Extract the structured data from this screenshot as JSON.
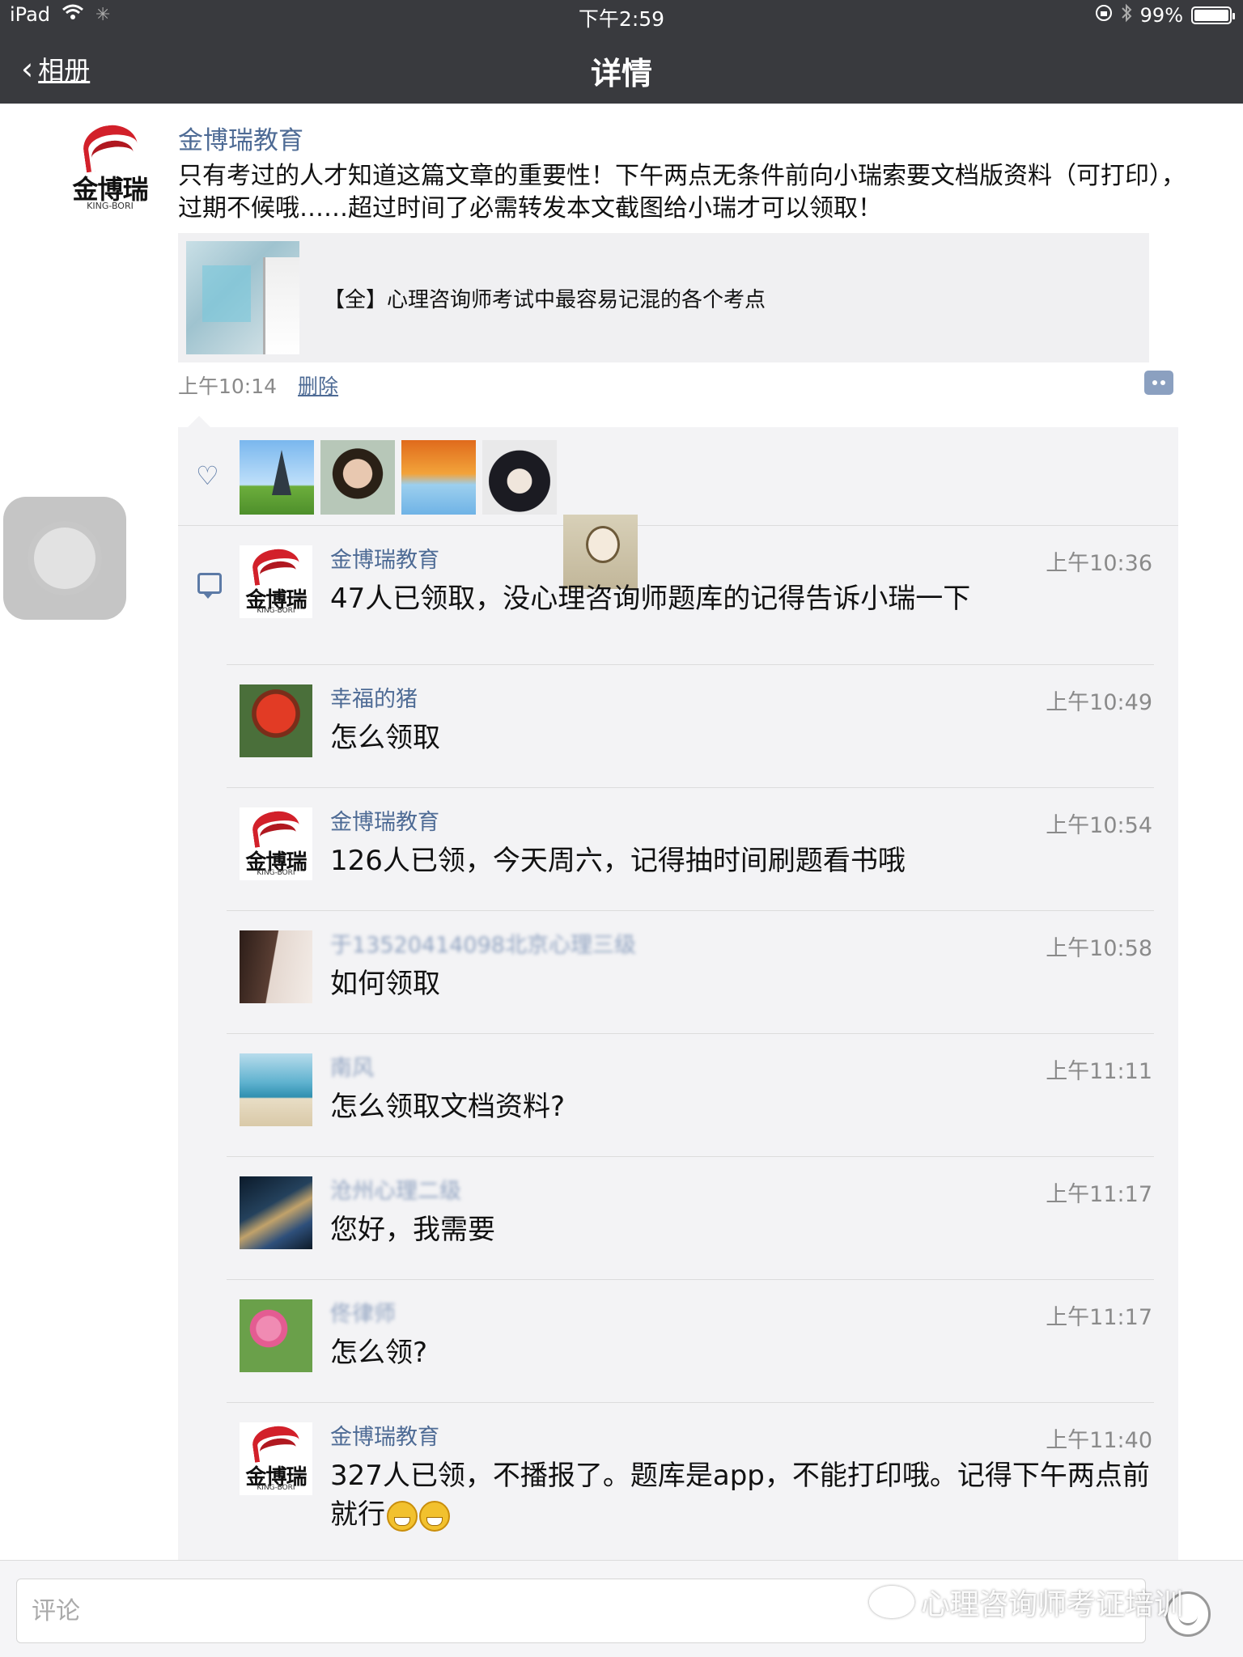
{
  "status_bar": {
    "device": "iPad",
    "time": "下午2:59",
    "battery": "99%"
  },
  "nav": {
    "back_label": "相册",
    "title": "详情"
  },
  "post": {
    "author": "金博瑞教育",
    "logo_brand": "金博瑞",
    "logo_sub": "KING-BORI",
    "text": "只有考过的人才知道这篇文章的重要性！下午两点无条件前向小瑞索要文档版资料（可打印），过期不候哦……超过时间了必需转发本文截图给小瑞才可以领取！",
    "link_title": "【全】心理咨询师考试中最容易记混的各个考点",
    "time": "上午10:14",
    "delete_label": "删除"
  },
  "likes": [
    {
      "icon": "eiffel-tower-photo"
    },
    {
      "icon": "young-man-photo"
    },
    {
      "icon": "autumn-leaves-photo"
    },
    {
      "icon": "anime-character-photo"
    },
    {
      "icon": "doll-drawing-photo"
    }
  ],
  "comments": [
    {
      "name": "金博瑞教育",
      "time": "上午10:36",
      "text": "47人已领取，没心理咨询师题库的记得告诉小瑞一下"
    },
    {
      "name": "幸福的猪",
      "time": "上午10:49",
      "text": "怎么领取"
    },
    {
      "name": "金博瑞教育",
      "time": "上午10:54",
      "text": "126人已领，今天周六，记得抽时间刷题看书哦"
    },
    {
      "name": "于13520414098北京心理三级",
      "time": "上午10:58",
      "text": "如何领取"
    },
    {
      "name": "南风",
      "time": "上午11:11",
      "text": "怎么领取文档资料?"
    },
    {
      "name": "沧州心理二级",
      "time": "上午11:17",
      "text": "您好，我需要"
    },
    {
      "name": "佟律师",
      "time": "上午11:17",
      "text": "怎么领?"
    },
    {
      "name": "金博瑞教育",
      "time": "上午11:40",
      "text": "327人已领，不播报了。题库是app，不能打印哦。记得下午两点前就行"
    }
  ],
  "footer": {
    "comment_placeholder": "评论",
    "watermark": "心理咨询师考证培训"
  },
  "colors": {
    "nav_bg": "#393a3e",
    "name_link": "#4e6b95",
    "panel_bg": "#f3f3f5",
    "brand_red": "#d2202a"
  }
}
